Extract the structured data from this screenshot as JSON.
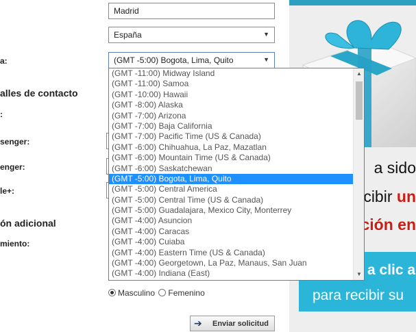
{
  "form": {
    "city_value": "Madrid",
    "country_value": "España",
    "timezone_label": "a:",
    "timezone_value": "(GMT -5:00) Bogota, Lima, Quito",
    "section_contact": "alles de contacto",
    "label_1": ":",
    "label_messenger1": "senger:",
    "label_messenger2": "enger:",
    "label_gplus": "le+:",
    "section_additional": "ón adicional",
    "label_birth": "miento:",
    "gender_male": "Masculino",
    "gender_female": "Femenino",
    "submit_label": "Enviar solicitud"
  },
  "dropdown": {
    "selected_index": 10,
    "options": [
      "(GMT -11:00) Midway Island",
      "(GMT -11:00) Samoa",
      "(GMT -10:00) Hawaii",
      "(GMT -8:00) Alaska",
      "(GMT -7:00) Arizona",
      "(GMT -7:00) Baja California",
      "(GMT -7:00) Pacific Time (US & Canada)",
      "(GMT -6:00) Chihuahua, La Paz, Mazatlan",
      "(GMT -6:00) Mountain Time (US & Canada)",
      "(GMT -6:00) Saskatchewan",
      "(GMT -5:00) Bogota, Lima, Quito",
      "(GMT -5:00) Central America",
      "(GMT -5:00) Central Time (US & Canada)",
      "(GMT -5:00) Guadalajara, Mexico City, Monterrey",
      "(GMT -4:00) Asuncion",
      "(GMT -4:00) Caracas",
      "(GMT -4:00) Cuiaba",
      "(GMT -4:00) Eastern Time (US & Canada)",
      "(GMT -4:00) Georgetown, La Paz, Manaus, San Juan",
      "(GMT -4:00) Indiana (East)"
    ]
  },
  "promo": {
    "line1": "a sido",
    "line2_a": "ecibir ",
    "line2_b": "un",
    "line3": "ción en",
    "cta_line1": "a clic a",
    "cta_line2": "para recibir su"
  },
  "colors": {
    "selected": "#1e90ff",
    "cta": "#2bb6d9",
    "ribbon": "#2d9fc0",
    "promo_red": "#cc1d14"
  }
}
